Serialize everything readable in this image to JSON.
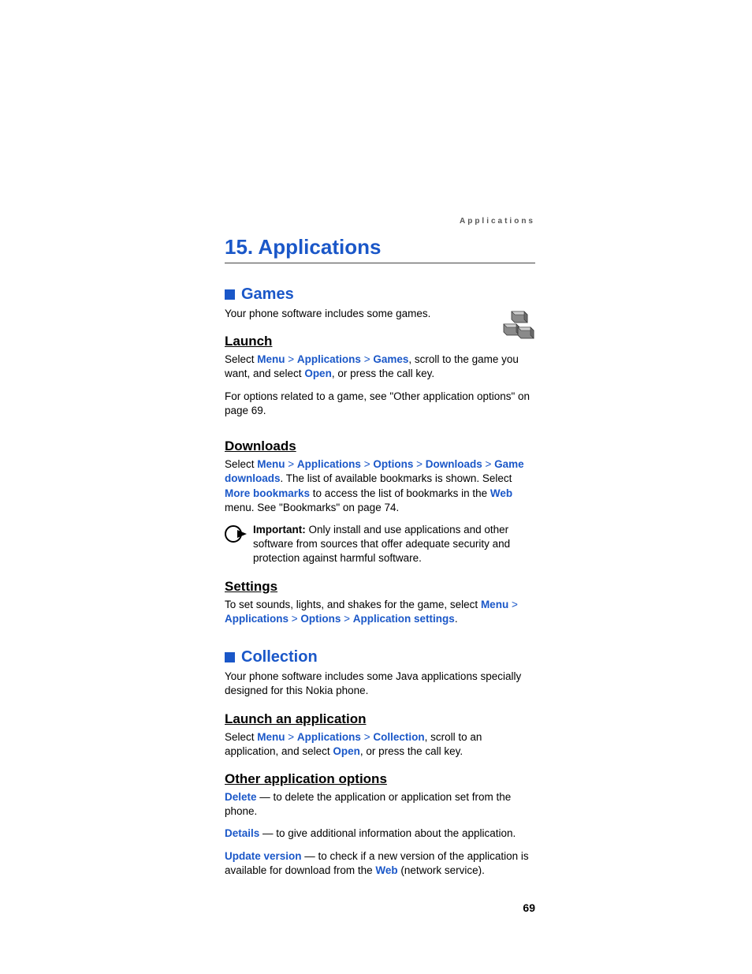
{
  "runningHead": "Applications",
  "chapter": {
    "number": "15.",
    "title": "Applications"
  },
  "games": {
    "heading": "Games",
    "intro": "Your phone software includes some games.",
    "launch": {
      "heading": "Launch",
      "p1_a": "Select ",
      "p1_menu": "Menu",
      "p1_sep": " > ",
      "p1_apps": "Applications",
      "p1_games": "Games",
      "p1_b": ", scroll to the game you want, and select ",
      "p1_open": "Open",
      "p1_c": ", or press the call key.",
      "p2": "For options related to a game, see \"Other application options\" on page 69."
    },
    "downloads": {
      "heading": "Downloads",
      "p1_a": "Select ",
      "menu": "Menu",
      "sep": " > ",
      "apps": "Applications",
      "options": "Options",
      "downloads": "Downloads",
      "gameDownloads": "Game downloads",
      "p1_b": ". The list of available bookmarks is shown. Select ",
      "moreBookmarks": "More bookmarks",
      "p1_c": " to access the list of bookmarks in the ",
      "web": "Web",
      "p1_d": " menu. See \"Bookmarks\" on page 74.",
      "important_label": "Important:",
      "important_text": " Only install and use applications and other software from sources that offer adequate security and protection against harmful software."
    },
    "settings": {
      "heading": "Settings",
      "p1_a": "To set sounds, lights, and shakes for the game, select ",
      "menu": "Menu",
      "sep": " > ",
      "apps": "Applications",
      "options": "Options",
      "appSettings": "Application settings",
      "p1_b": "."
    }
  },
  "collection": {
    "heading": "Collection",
    "intro": "Your phone software includes some Java applications specially designed for this Nokia phone.",
    "launchApp": {
      "heading": "Launch an application",
      "p1_a": "Select ",
      "menu": "Menu",
      "sep": " > ",
      "apps": "Applications",
      "collection": "Collection",
      "p1_b": ", scroll to an application, and select ",
      "open": "Open",
      "p1_c": ", or press the call key."
    },
    "other": {
      "heading": "Other application options",
      "delete_key": "Delete",
      "delete_text": " — to delete the application or application set from the phone.",
      "details_key": "Details",
      "details_text": " — to give additional information about the application.",
      "update_key": "Update version",
      "update_text_a": " — to check if a new version of the application is available for download from the ",
      "web": "Web",
      "update_text_b": " (network service)."
    }
  },
  "pageNumber": "69"
}
